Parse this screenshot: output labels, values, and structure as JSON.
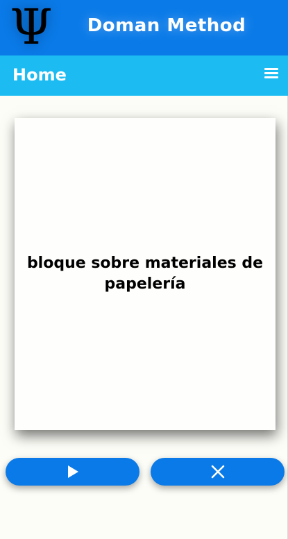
{
  "header": {
    "logo_glyph": "Ψ",
    "app_title": "Doman Method",
    "color": "#0a7ae8"
  },
  "nav": {
    "title": "Home",
    "menu_icon": "hamburger-menu-icon",
    "color": "#1cbcf2"
  },
  "card": {
    "text": "bloque sobre materiales de papelería"
  },
  "controls": {
    "play_icon": "play-icon",
    "close_icon": "close-icon",
    "button_color": "#0a7ae8"
  }
}
